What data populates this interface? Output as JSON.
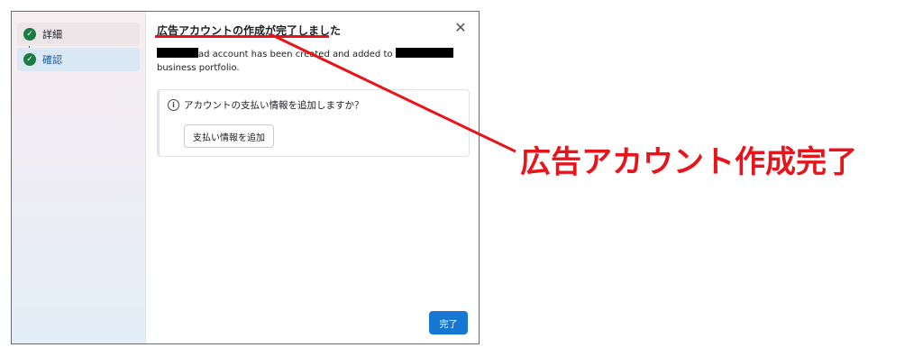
{
  "sidebar": {
    "steps": [
      {
        "label": "詳細",
        "status": "completed",
        "icon": "check-circle-icon"
      },
      {
        "label": "確認",
        "status": "completed",
        "icon": "check-circle-icon"
      }
    ]
  },
  "dialog": {
    "title": "広告アカウントの作成が完了しました",
    "close_icon": "close-icon",
    "message_part1": "ad account has been created and added to",
    "message_part2": "business portfolio.",
    "card": {
      "question": "アカウントの支払い情報を追加しますか？",
      "info_icon": "info-icon",
      "add_payment_label": "支払い情報を追加"
    },
    "done_label": "完了"
  },
  "annotation": {
    "text": "広告アカウント作成完了",
    "color": "#e8141c"
  },
  "colors": {
    "accent": "#1877d2",
    "success": "#1c7a43"
  }
}
